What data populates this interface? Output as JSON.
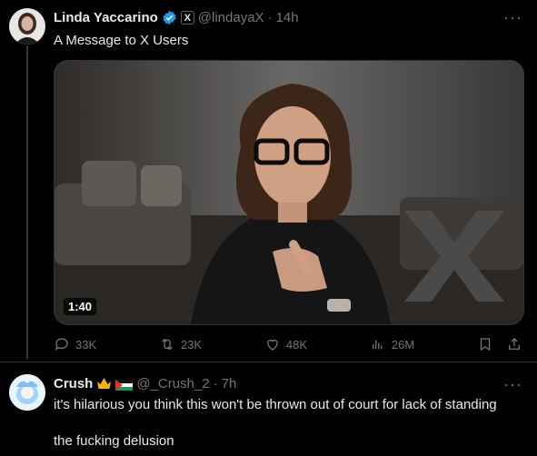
{
  "post": {
    "author_name": "Linda Yaccarino",
    "author_handle": "@lindayaX",
    "time": "14h",
    "separator": "·",
    "affiliate_badge": "X",
    "text": "A Message to X Users",
    "video_duration": "1:40",
    "stats": {
      "replies": "33K",
      "reposts": "23K",
      "likes": "48K",
      "views": "26M"
    }
  },
  "reply": {
    "author_name": "Crush",
    "author_handle": "@_Crush_2",
    "time": "7h",
    "separator": "·",
    "text_line1": "it's hilarious you think this won't be thrown out of court for lack of standing",
    "text_line2": "the fucking delusion"
  },
  "more_label": "···",
  "colors": {
    "background": "#000000",
    "text": "#e7e9ea",
    "muted": "#71767b",
    "verified": "#1d9bf0",
    "divider": "#2f3336"
  }
}
